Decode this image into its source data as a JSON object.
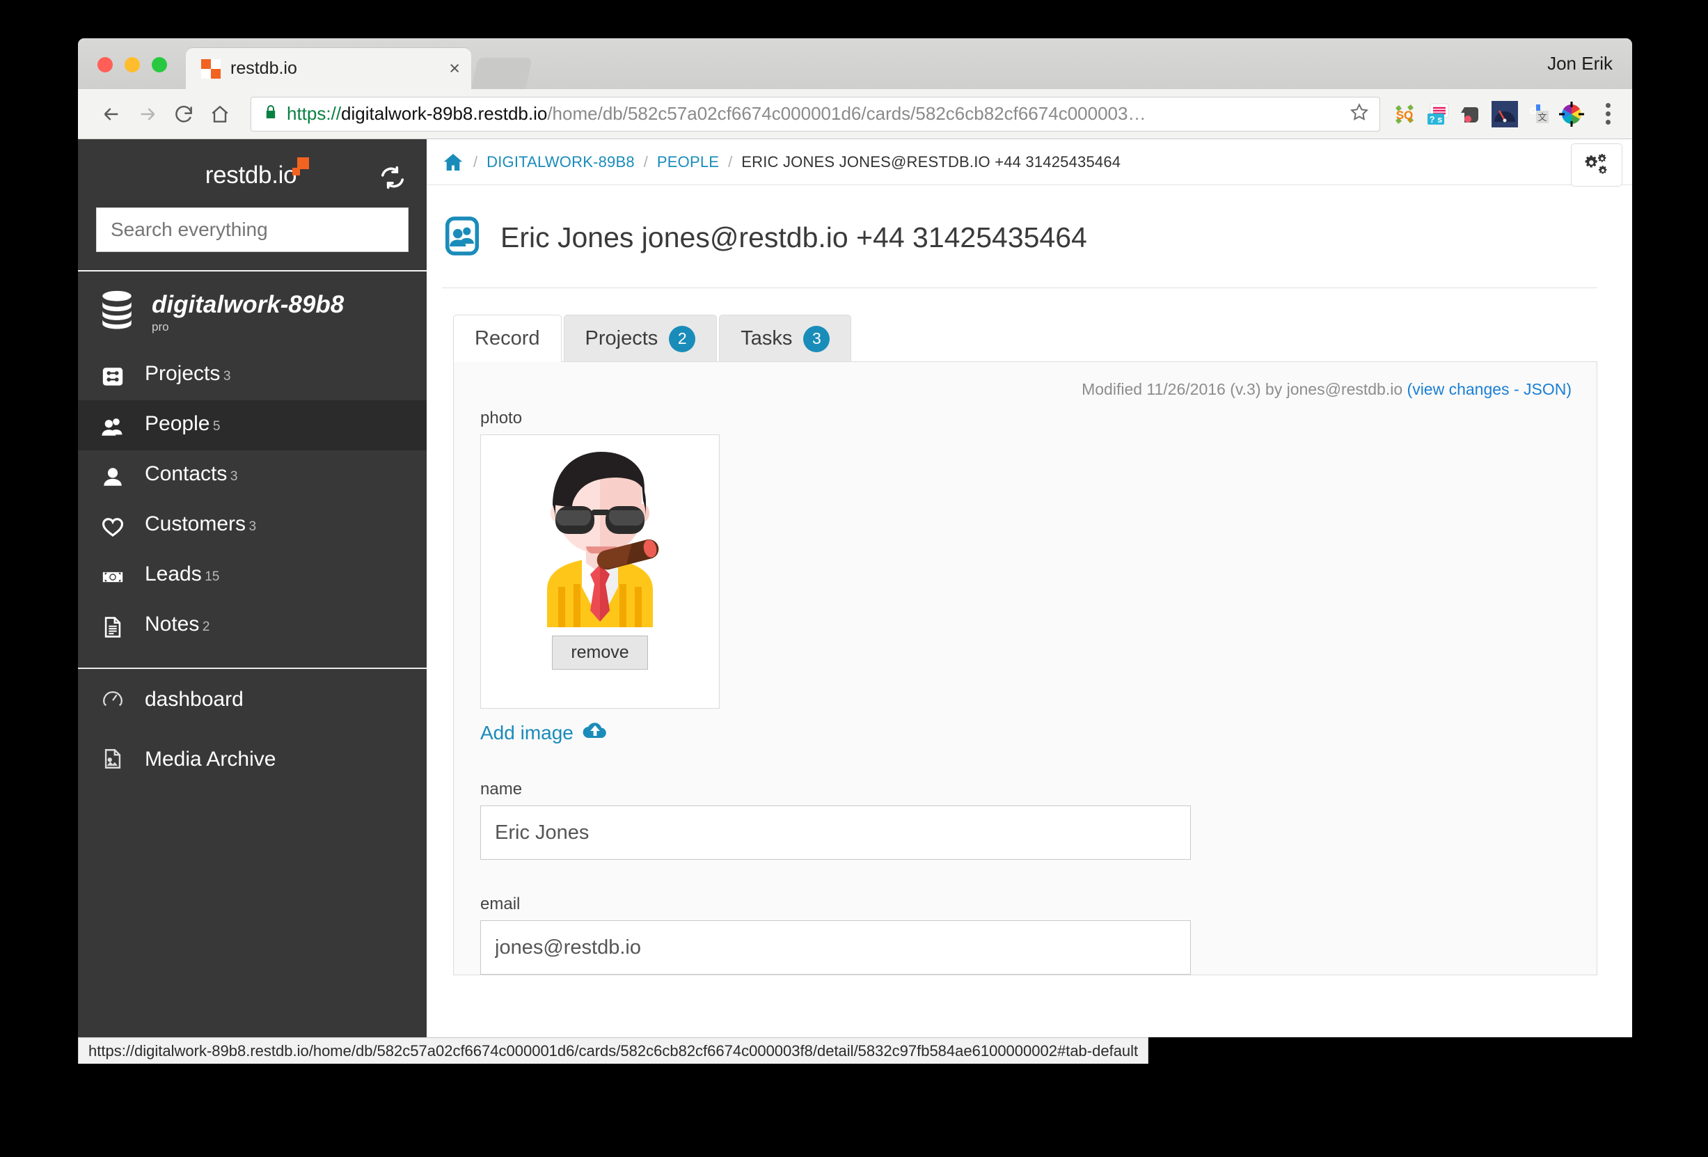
{
  "browser": {
    "tab_title": "restdb.io",
    "tab_close": "×",
    "profile_name": "Jon Erik",
    "url_scheme": "https://",
    "url_host": "digitalwork-89b8.restdb.io",
    "url_path": "/home/db/582c57a02cf6674c000001d6/cards/582c6cb82cf6674c000003…",
    "status_url": "https://digitalwork-89b8.restdb.io/home/db/582c57a02cf6674c000001d6/cards/582c6cb82cf6674c000003f8/detail/5832c97fb584ae6100000002#tab-default",
    "extensions": [
      {
        "name": "squarespace-extension-icon",
        "label": "SQ"
      },
      {
        "name": "question-s-extension-icon",
        "label": "? s"
      },
      {
        "name": "evernote-extension-icon",
        "label": ""
      },
      {
        "name": "speedometer-extension-icon",
        "label": ""
      },
      {
        "name": "google-translate-extension-icon",
        "label": "G"
      },
      {
        "name": "color-picker-extension-icon",
        "label": ""
      }
    ]
  },
  "sidebar": {
    "brand": "restdb.io",
    "search_placeholder": "Search everything",
    "database_name": "digitalwork-89b8",
    "database_plan": "pro",
    "items": [
      {
        "label": "Projects",
        "count": "3",
        "icon": "projects-icon",
        "active": false
      },
      {
        "label": "People",
        "count": "5",
        "icon": "people-icon",
        "active": true
      },
      {
        "label": "Contacts",
        "count": "3",
        "icon": "contact-icon",
        "active": false
      },
      {
        "label": "Customers",
        "count": "3",
        "icon": "heart-icon",
        "active": false
      },
      {
        "label": "Leads",
        "count": "15",
        "icon": "money-icon",
        "active": false
      },
      {
        "label": "Notes",
        "count": "2",
        "icon": "document-icon",
        "active": false
      }
    ],
    "footer_items": [
      {
        "label": "dashboard",
        "icon": "gauge-icon"
      },
      {
        "label": "Media Archive",
        "icon": "media-icon"
      }
    ]
  },
  "breadcrumb": {
    "home_icon": "home-icon",
    "db": "DIGITALWORK-89B8",
    "collection": "PEOPLE",
    "current": "ERIC JONES JONES@RESTDB.IO +44 31425435464",
    "separator": "/"
  },
  "page": {
    "title": "Eric Jones jones@restdb.io +44 31425435464",
    "icon": "person-card-icon",
    "settings_icon": "gears-icon"
  },
  "tabs": [
    {
      "label": "Record",
      "badge": "",
      "active": true
    },
    {
      "label": "Projects",
      "badge": "2",
      "active": false
    },
    {
      "label": "Tasks",
      "badge": "3",
      "active": false
    }
  ],
  "record": {
    "modified_text": "Modified 11/26/2016 (v.3) by jones@restdb.io",
    "view_changes_link": "(view changes - JSON)",
    "photo_label": "photo",
    "remove_label": "remove",
    "add_image_label": "Add image",
    "add_image_icon": "cloud-upload-icon",
    "fields": [
      {
        "label": "name",
        "value": "Eric Jones"
      },
      {
        "label": "email",
        "value": "jones@restdb.io"
      }
    ]
  },
  "colors": {
    "accent": "#1a8cba",
    "brand_orange": "#f26322",
    "sidebar_bg": "#383838",
    "sidebar_active": "#2b2b2b",
    "link": "#1a7fd4"
  }
}
